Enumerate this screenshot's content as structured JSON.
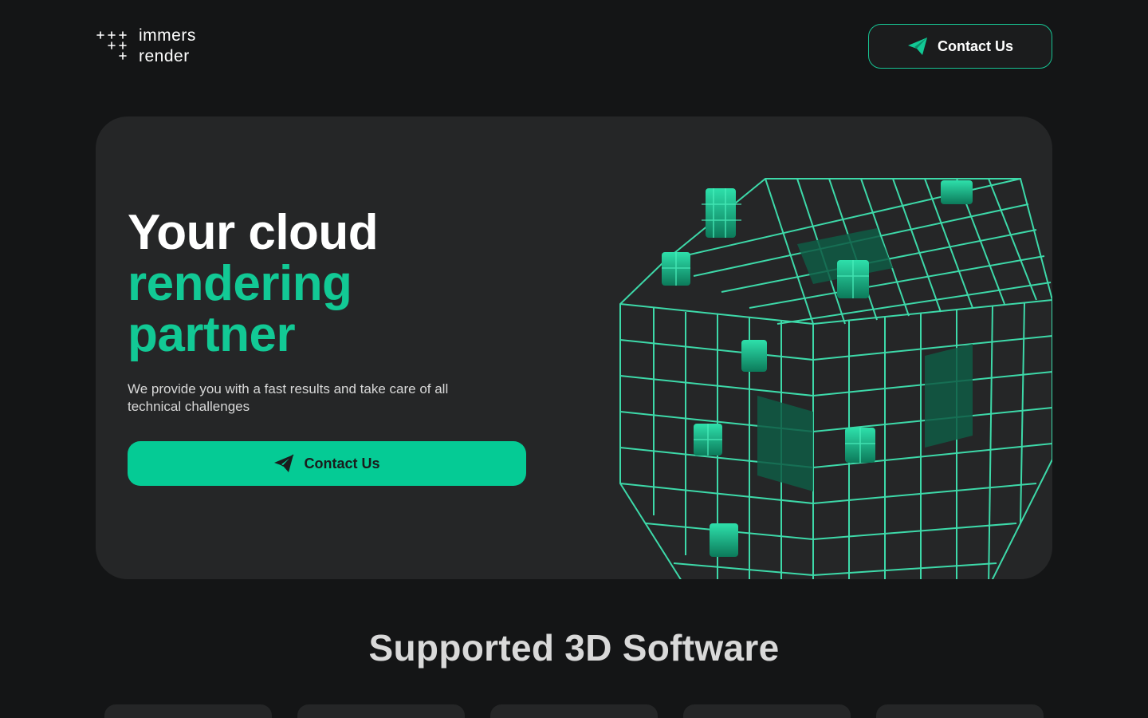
{
  "brand": {
    "line1": "immers",
    "line2": "render"
  },
  "header": {
    "contact_label": "Contact Us"
  },
  "hero": {
    "title_line1": "Your cloud",
    "title_line2": "rendering",
    "title_line3": "partner",
    "subtitle": "We provide you with a fast results and take care of all technical challenges",
    "cta_label": "Contact Us"
  },
  "software": {
    "title": "Supported 3D Software",
    "cards": [
      "",
      "",
      "",
      "",
      ""
    ]
  },
  "colors": {
    "accent": "#05cb95",
    "background": "#141516",
    "panel": "#252627"
  },
  "icons": [
    "plus-grid-logo-icon",
    "paper-plane-icon"
  ]
}
